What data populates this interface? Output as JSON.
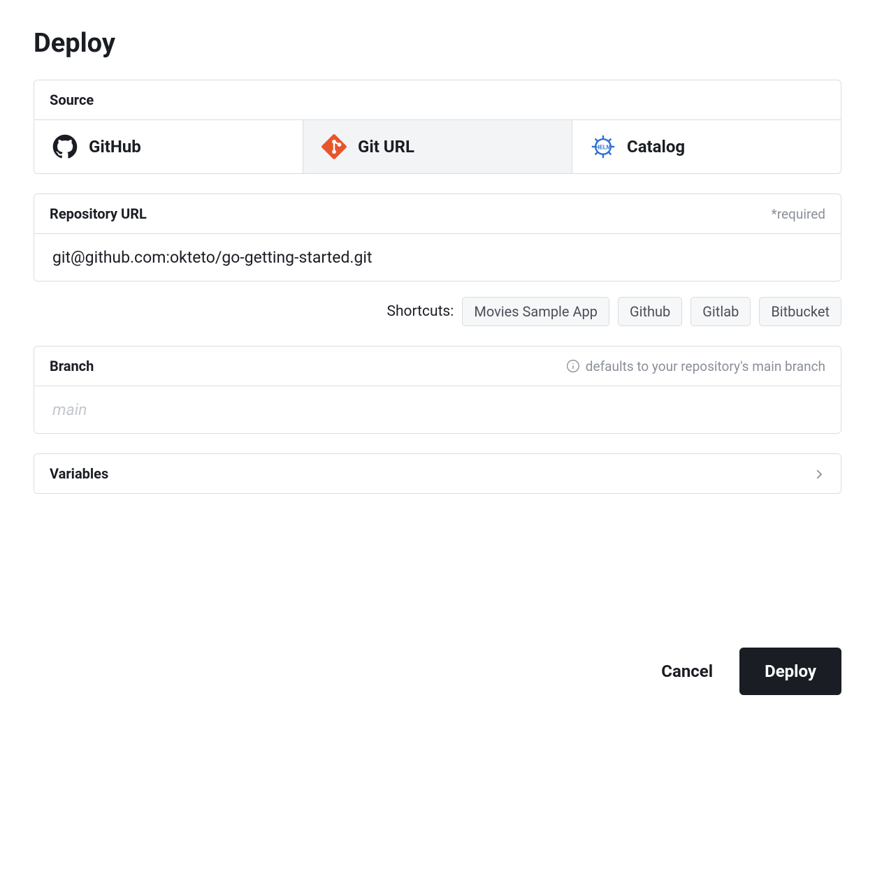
{
  "title": "Deploy",
  "source": {
    "header": "Source",
    "tabs": {
      "github": "GitHub",
      "giturl": "Git URL",
      "catalog": "Catalog"
    },
    "selected": "giturl"
  },
  "repo": {
    "header": "Repository URL",
    "required_tag": "*required",
    "value": "git@github.com:okteto/go-getting-started.git"
  },
  "shortcuts": {
    "label": "Shortcuts:",
    "items": [
      "Movies Sample App",
      "Github",
      "Gitlab",
      "Bitbucket"
    ]
  },
  "branch": {
    "header": "Branch",
    "hint": "defaults to your repository's main branch",
    "placeholder": "main",
    "value": ""
  },
  "variables": {
    "header": "Variables"
  },
  "actions": {
    "cancel": "Cancel",
    "deploy": "Deploy"
  }
}
